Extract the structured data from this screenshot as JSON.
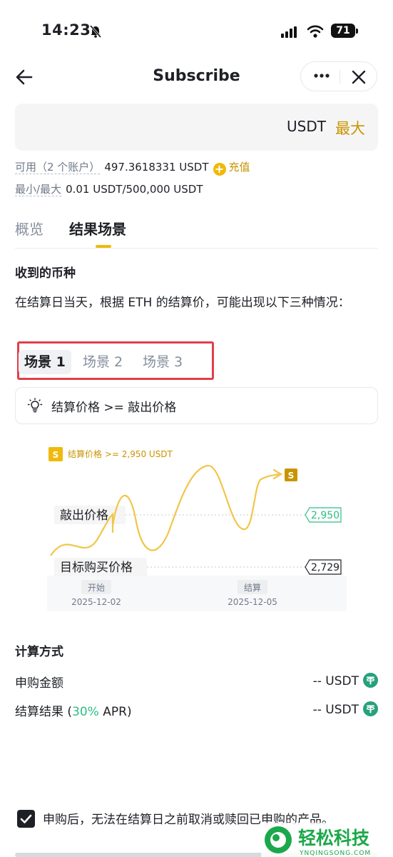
{
  "status_bar": {
    "time": "14:23",
    "battery": "71"
  },
  "header": {
    "title": "Subscribe"
  },
  "amount": {
    "unit": "USDT",
    "max_label": "最大"
  },
  "available": {
    "label": "可用（2 个账户）",
    "value": "497.3618331 USDT",
    "recharge": "充值"
  },
  "limits": {
    "label": "最小/最大",
    "value": "0.01 USDT/500,000 USDT"
  },
  "tabs": [
    {
      "label": "概览"
    },
    {
      "label": "结果场景"
    }
  ],
  "received": {
    "title": "收到的币种",
    "description": "在结算日当天，根据 ETH 的结算价，可能出现以下三种情况："
  },
  "scenarios": [
    {
      "label": "场景 1"
    },
    {
      "label": "场景 2"
    },
    {
      "label": "场景 3"
    }
  ],
  "condition": "结算价格 >= 敲出价格",
  "chart_data": {
    "type": "line",
    "annotation": "结算价格 >= 2,950 USDT",
    "badge": "S",
    "levels": [
      {
        "name": "敲出价格",
        "value": 2950,
        "label": "2,950",
        "color": "#2ebd85"
      },
      {
        "name": "目标购买价格",
        "value": 2729,
        "label": "2,729",
        "color": "#1e2026"
      }
    ],
    "x_ticks": [
      {
        "tag": "开始",
        "date": "2025-12-02"
      },
      {
        "tag": "结算",
        "date": "2025-12-05"
      }
    ],
    "line_color": "#f0c64a"
  },
  "calc": {
    "title": "计算方式",
    "subscribe_label": "申购金额",
    "subscribe_value": "-- USDT",
    "result_label_prefix": "结算结果 (",
    "apr": "30%",
    "result_label_suffix": " APR)",
    "result_value": "-- USDT"
  },
  "notice": "申购后，无法在结算日之前取消或赎回已申购的产品。",
  "watermark": {
    "title": "轻松科技",
    "url": "YNQINGSONG.COM"
  }
}
